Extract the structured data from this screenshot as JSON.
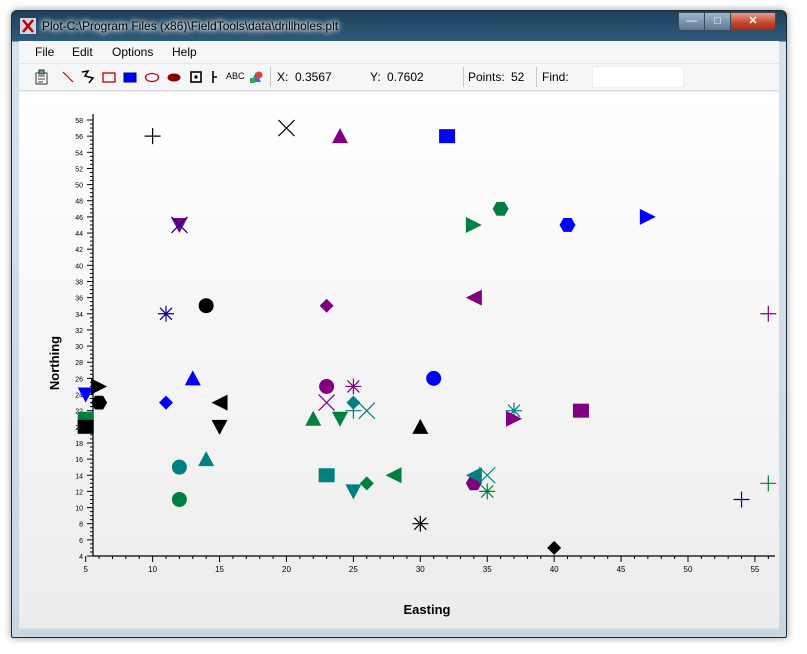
{
  "window": {
    "title": "Plot-C:\\Program Files (x86)\\FieldTools\\data\\drillholes.plt"
  },
  "menu": [
    "File",
    "Edit",
    "Options",
    "Help"
  ],
  "toolbar": {
    "tools": [
      "select-icon",
      "line-icon",
      "freehand-icon",
      "rectangle-icon",
      "filled-rectangle-icon",
      "ellipse-icon",
      "filled-ellipse-icon",
      "point-icon",
      "marker-icon",
      "text-icon",
      "color-icon"
    ],
    "text_tool_label": "ABC",
    "x_label": "X:",
    "x_value": "0.3567",
    "y_label": "Y:",
    "y_value": "0.7602",
    "points_label": "Points:",
    "points_value": "52",
    "find_label": "Find:",
    "find_value": ""
  },
  "colors": {
    "black": "#000000",
    "navy": "#00008b",
    "blue": "#0000ff",
    "purple": "#800080",
    "teal": "#008080",
    "green": "#008040"
  },
  "chart_data": {
    "type": "scatter",
    "xlabel": "Easting",
    "ylabel": "Northing",
    "xlim": [
      4.5,
      56.5
    ],
    "ylim": [
      4,
      58
    ],
    "x_ticks": [
      5,
      10,
      15,
      20,
      25,
      30,
      35,
      40,
      45,
      50,
      55
    ],
    "y_ticks": [
      4,
      6,
      8,
      10,
      12,
      14,
      16,
      18,
      20,
      22,
      24,
      26,
      28,
      30,
      32,
      34,
      36,
      38,
      40,
      42,
      44,
      46,
      48,
      50,
      52,
      54,
      56,
      58
    ],
    "points": [
      {
        "x": 10,
        "y": 56,
        "shape": "plus",
        "color": "black"
      },
      {
        "x": 20,
        "y": 57,
        "shape": "cross",
        "color": "black"
      },
      {
        "x": 24,
        "y": 56,
        "shape": "triangle-up",
        "color": "purple"
      },
      {
        "x": 32,
        "y": 56,
        "shape": "square",
        "color": "blue"
      },
      {
        "x": 12,
        "y": 45,
        "shape": "triangle-down",
        "color": "purple"
      },
      {
        "x": 12,
        "y": 45,
        "shape": "cross",
        "color": "navy"
      },
      {
        "x": 34,
        "y": 45,
        "shape": "triangle-right",
        "color": "green"
      },
      {
        "x": 36,
        "y": 47,
        "shape": "hexagon",
        "color": "green"
      },
      {
        "x": 41,
        "y": 45,
        "shape": "hexagon",
        "color": "blue"
      },
      {
        "x": 47,
        "y": 46,
        "shape": "triangle-right",
        "color": "blue"
      },
      {
        "x": 11,
        "y": 34,
        "shape": "asterisk",
        "color": "navy"
      },
      {
        "x": 14,
        "y": 35,
        "shape": "circle",
        "color": "black"
      },
      {
        "x": 23,
        "y": 35,
        "shape": "diamond",
        "color": "purple"
      },
      {
        "x": 34,
        "y": 36,
        "shape": "triangle-left",
        "color": "purple"
      },
      {
        "x": 56,
        "y": 34,
        "shape": "plus",
        "color": "purple"
      },
      {
        "x": 5,
        "y": 24,
        "shape": "triangle-down",
        "color": "blue"
      },
      {
        "x": 6,
        "y": 25,
        "shape": "triangle-right",
        "color": "black"
      },
      {
        "x": 6,
        "y": 23,
        "shape": "hexagon",
        "color": "black"
      },
      {
        "x": 5,
        "y": 21,
        "shape": "square",
        "color": "green"
      },
      {
        "x": 5,
        "y": 20,
        "shape": "square",
        "color": "black"
      },
      {
        "x": 11,
        "y": 23,
        "shape": "diamond",
        "color": "blue"
      },
      {
        "x": 13,
        "y": 26,
        "shape": "triangle-up",
        "color": "blue"
      },
      {
        "x": 15,
        "y": 23,
        "shape": "triangle-left",
        "color": "black"
      },
      {
        "x": 15,
        "y": 20,
        "shape": "triangle-down",
        "color": "black"
      },
      {
        "x": 12,
        "y": 15,
        "shape": "circle",
        "color": "teal"
      },
      {
        "x": 14,
        "y": 16,
        "shape": "triangle-up",
        "color": "teal"
      },
      {
        "x": 12,
        "y": 11,
        "shape": "circle",
        "color": "green"
      },
      {
        "x": 22,
        "y": 21,
        "shape": "triangle-up",
        "color": "green"
      },
      {
        "x": 23,
        "y": 23,
        "shape": "cross",
        "color": "purple"
      },
      {
        "x": 23,
        "y": 25,
        "shape": "circle",
        "color": "purple"
      },
      {
        "x": 24,
        "y": 21,
        "shape": "triangle-down",
        "color": "green"
      },
      {
        "x": 25,
        "y": 25,
        "shape": "asterisk",
        "color": "purple"
      },
      {
        "x": 25,
        "y": 23,
        "shape": "diamond",
        "color": "teal"
      },
      {
        "x": 25,
        "y": 22,
        "shape": "plus",
        "color": "teal"
      },
      {
        "x": 26,
        "y": 22,
        "shape": "cross",
        "color": "teal"
      },
      {
        "x": 23,
        "y": 14,
        "shape": "square",
        "color": "teal"
      },
      {
        "x": 25,
        "y": 12,
        "shape": "triangle-down",
        "color": "teal"
      },
      {
        "x": 26,
        "y": 13,
        "shape": "diamond",
        "color": "green"
      },
      {
        "x": 28,
        "y": 14,
        "shape": "triangle-left",
        "color": "green"
      },
      {
        "x": 30,
        "y": 20,
        "shape": "triangle-up",
        "color": "black"
      },
      {
        "x": 30,
        "y": 8,
        "shape": "asterisk",
        "color": "black"
      },
      {
        "x": 31,
        "y": 26,
        "shape": "circle",
        "color": "blue"
      },
      {
        "x": 34,
        "y": 13,
        "shape": "hexagon",
        "color": "purple"
      },
      {
        "x": 34,
        "y": 14,
        "shape": "triangle-left",
        "color": "teal"
      },
      {
        "x": 35,
        "y": 14,
        "shape": "cross",
        "color": "teal"
      },
      {
        "x": 35,
        "y": 12,
        "shape": "asterisk",
        "color": "green"
      },
      {
        "x": 37,
        "y": 22,
        "shape": "asterisk",
        "color": "teal"
      },
      {
        "x": 37,
        "y": 21,
        "shape": "triangle-right",
        "color": "purple"
      },
      {
        "x": 42,
        "y": 22,
        "shape": "square",
        "color": "purple"
      },
      {
        "x": 40,
        "y": 5,
        "shape": "diamond",
        "color": "black"
      },
      {
        "x": 54,
        "y": 11,
        "shape": "plus",
        "color": "navy"
      },
      {
        "x": 56,
        "y": 13,
        "shape": "plus",
        "color": "green"
      }
    ]
  }
}
